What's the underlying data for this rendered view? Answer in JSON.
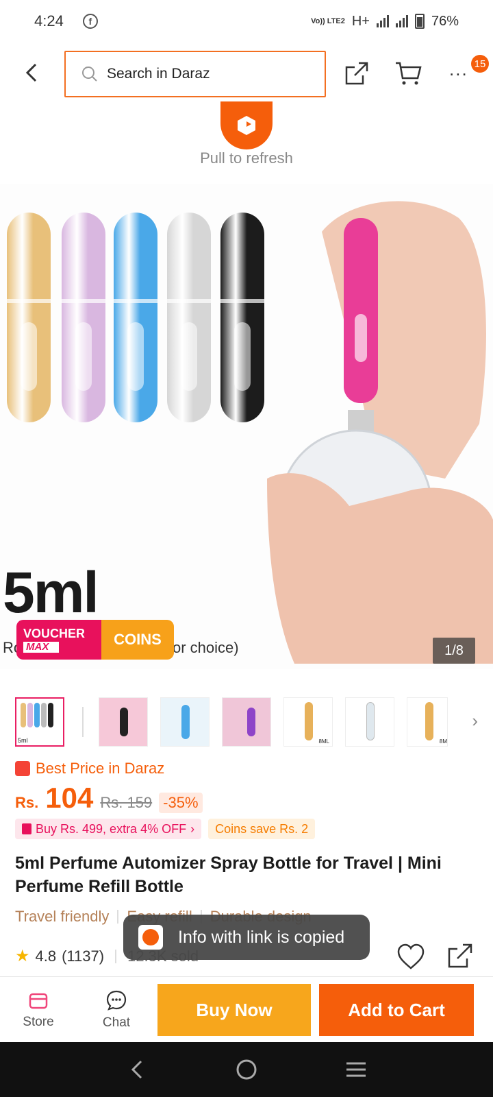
{
  "status_bar": {
    "time": "4:24",
    "network_label": "Vo)) LTE2",
    "network_type": "H+",
    "battery": "76%",
    "app_icon": "facebook-icon"
  },
  "header": {
    "back_icon": "chevron-left-icon",
    "search_placeholder": "Search in Daraz",
    "share_icon": "share-icon",
    "cart_icon": "cart-icon",
    "more_icon": "more-icon",
    "more_label": "...",
    "badge_count": "15"
  },
  "refresh": {
    "text": "Pull to refresh"
  },
  "product_image": {
    "size_text": "5ml",
    "caption_start": "Ro",
    "caption_end": "or choice)",
    "voucher_line1": "VOUCHER",
    "voucher_line2": "MAX",
    "coins_label": "COINS",
    "counter": "1/8",
    "bottle_colors": [
      "#e8c07a",
      "#d9b7e0",
      "#4aa8e8",
      "#d6d6d6",
      "#1c1c1c"
    ]
  },
  "thumbnails": {
    "count": 7,
    "colors": [
      "#f4c6d6",
      "#f6c8d8",
      "#bfe0f4",
      "#f0c6d8",
      "#e7b15a",
      "#dfe8ee",
      "#e7b15a"
    ],
    "labels": [
      "5ml",
      "",
      "",
      "",
      "8ML",
      "",
      "8M"
    ],
    "next_icon": "chevron-right-icon"
  },
  "price": {
    "best_price_label": "Best Price in Daraz",
    "currency": "Rs.",
    "current": "104",
    "original": "Rs. 159",
    "discount": "-35%",
    "promo_buy": "Buy Rs. 499, extra 4% OFF",
    "promo_coins": "Coins save Rs. 2"
  },
  "product": {
    "title": "5ml Perfume Automizer Spray Bottle for Travel | Mini Perfume Refill Bottle",
    "features": [
      "Travel friendly",
      "Easy refill",
      "Durable design"
    ],
    "rating": "4.8",
    "rating_count": "(1137)",
    "sold": "12.3K sold"
  },
  "toast": {
    "text": "Info with link is copied"
  },
  "action_bar": {
    "store_label": "Store",
    "chat_label": "Chat",
    "buy_now_label": "Buy Now",
    "add_to_cart_label": "Add to Cart"
  },
  "colors": {
    "brand_orange": "#f55e0b",
    "buy_now_yellow": "#f7a61c",
    "voucher_pink": "#e8115c"
  }
}
